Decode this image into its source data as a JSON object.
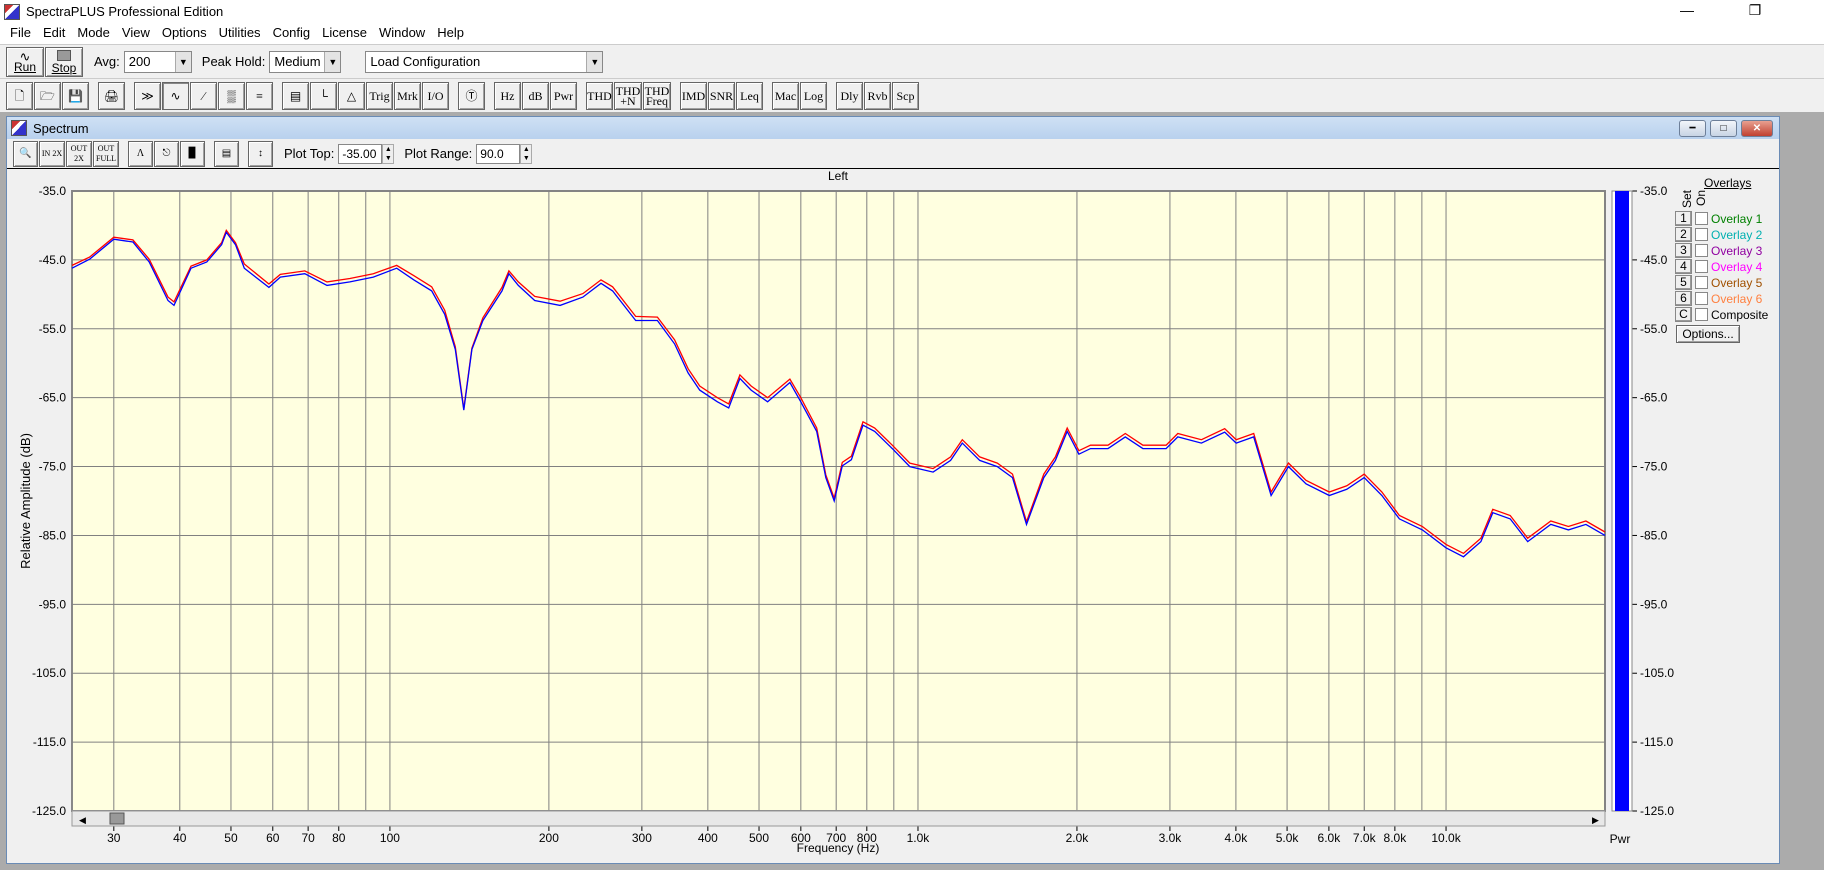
{
  "app": {
    "title": "SpectraPLUS Professional Edition",
    "window_controls": [
      "minimize",
      "restore"
    ]
  },
  "menu": [
    "File",
    "Edit",
    "Mode",
    "View",
    "Options",
    "Utilities",
    "Config",
    "License",
    "Window",
    "Help"
  ],
  "toolbar1": {
    "run_label": "Run",
    "stop_label": "Stop",
    "avg_label": "Avg:",
    "avg_value": "200",
    "peak_hold_label": "Peak Hold:",
    "peak_hold_value": "Medium",
    "config_value": "Load Configuration"
  },
  "toolbar2": {
    "icons_a": [
      "new-file",
      "open-file",
      "save-file",
      "print"
    ],
    "icons_b": [
      "averaging",
      "spectrum-mode",
      "phase",
      "spectrogram",
      "3d-surface"
    ],
    "icons_c": [
      "numeric-display",
      "scope",
      "generator"
    ],
    "labels": [
      "Trig",
      "Mrk",
      "I/O"
    ],
    "signal_icon": "sine-wave",
    "labels2": [
      "Hz",
      "dB",
      "Pwr"
    ],
    "labels3": [
      "THD",
      "THD +N",
      "THD Freq"
    ],
    "labels4": [
      "IMD",
      "SNR",
      "Leq"
    ],
    "labels5": [
      "Mac",
      "Log"
    ],
    "labels6": [
      "Dly",
      "Rvb",
      "Scp"
    ]
  },
  "spectrum": {
    "title": "Spectrum",
    "zoom_buttons": [
      "IN 2X",
      "OUT 2X",
      "OUT FULL"
    ],
    "plot_top_label": "Plot Top:",
    "plot_top_value": "-35.00",
    "plot_range_label": "Plot Range:",
    "plot_range_value": "90.0",
    "overlays": {
      "title": "Overlays",
      "set_label": "Set",
      "on_label": "On",
      "items": [
        {
          "set": "1",
          "label": "Overlay 1",
          "color": "#008000"
        },
        {
          "set": "2",
          "label": "Overlay 2",
          "color": "#00b0b0"
        },
        {
          "set": "3",
          "label": "Overlay 3",
          "color": "#9000a0"
        },
        {
          "set": "4",
          "label": "Overlay 4",
          "color": "#ff00ff"
        },
        {
          "set": "5",
          "label": "Overlay 5",
          "color": "#a05000"
        },
        {
          "set": "6",
          "label": "Overlay 6",
          "color": "#ff8040"
        },
        {
          "set": "C",
          "label": "Composite",
          "color": "#000000"
        }
      ],
      "options_label": "Options..."
    },
    "pwr_label": "Pwr",
    "pwr_color": "#0000ff",
    "pwr_level_percent": 100
  },
  "chart_data": {
    "type": "line",
    "title": "Left",
    "xlabel": "Frequency (Hz)",
    "ylabel": "Relative Amplitude (dB)",
    "xscale": "log",
    "xlim": [
      25,
      20000
    ],
    "ylim": [
      -125,
      -35
    ],
    "grid": true,
    "background": "#ffffe0",
    "yticks": [
      -35,
      -45,
      -55,
      -65,
      -75,
      -85,
      -95,
      -105,
      -115,
      -125
    ],
    "ytick_labels": [
      "-35.0",
      "-45.0",
      "-55.0",
      "-65.0",
      "-75.0",
      "-85.0",
      "-95.0",
      "-105.0",
      "-115.0",
      "-125.0"
    ],
    "xgrid": [
      30,
      40,
      50,
      60,
      70,
      80,
      90,
      100,
      200,
      300,
      400,
      500,
      600,
      700,
      800,
      900,
      1000,
      2000,
      3000,
      4000,
      5000,
      6000,
      7000,
      8000,
      9000,
      10000,
      20000
    ],
    "xticks": [
      30,
      40,
      50,
      60,
      70,
      80,
      100,
      200,
      300,
      400,
      500,
      600,
      700,
      800,
      1000,
      2000,
      3000,
      4000,
      5000,
      6000,
      7000,
      8000,
      10000
    ],
    "xtick_labels": [
      "30",
      "40",
      "50",
      "60",
      "70",
      "80",
      "100",
      "200",
      "300",
      "400",
      "500",
      "600",
      "700",
      "800",
      "1.0k",
      "2.0k",
      "3.0k",
      "4.0k",
      "5.0k",
      "6.0k",
      "7.0k",
      "8.0k",
      "10.0k"
    ],
    "x": [
      25,
      27,
      30,
      32.6,
      35,
      38,
      39,
      42,
      45,
      48,
      49,
      51,
      53,
      59,
      62,
      69,
      76,
      84,
      93,
      103,
      111,
      120,
      127,
      133,
      138,
      143,
      150,
      163,
      168,
      175,
      188,
      210,
      232,
      251,
      264,
      292,
      321,
      346,
      367,
      386,
      417,
      438,
      460,
      483,
      519,
      572,
      600,
      643,
      669,
      694,
      719,
      748,
      787,
      828,
      894,
      965,
      1068,
      1153,
      1213,
      1309,
      1413,
      1510,
      1605,
      1731,
      1821,
      1917,
      2017,
      2122,
      2290,
      2470,
      2667,
      2950,
      3105,
      3441,
      3810,
      4006,
      4322,
      4663,
      5032,
      5430,
      6010,
      6488,
      7000,
      7560,
      8160,
      9020,
      10000,
      10790,
      11640,
      12260,
      13230,
      14280,
      15790,
      17050,
      18400,
      20000
    ],
    "series": [
      {
        "color": "#0000ff",
        "values": [
          -46.2,
          -44.9,
          -42,
          -42.4,
          -45.3,
          -50.9,
          -51.6,
          -46.2,
          -45.3,
          -42.8,
          -41,
          -42.8,
          -46.2,
          -49,
          -47.5,
          -47,
          -48.7,
          -48.2,
          -47.5,
          -46.2,
          -47.9,
          -49.5,
          -52.9,
          -58,
          -66.8,
          -58,
          -53.8,
          -49.5,
          -47,
          -48.7,
          -50.9,
          -51.6,
          -50.4,
          -48.4,
          -49.5,
          -53.8,
          -53.8,
          -57.2,
          -61.4,
          -63.9,
          -65.6,
          -66.5,
          -62.2,
          -63.9,
          -65.6,
          -62.8,
          -65.6,
          -69.9,
          -76.6,
          -80,
          -74.9,
          -74,
          -69,
          -69.9,
          -72.4,
          -75,
          -75.8,
          -74.1,
          -71.6,
          -74.1,
          -75,
          -76.6,
          -83.4,
          -76.6,
          -74.1,
          -69.9,
          -73.2,
          -72.4,
          -72.4,
          -70.7,
          -72.4,
          -72.4,
          -70.7,
          -71.6,
          -70,
          -71.6,
          -70.7,
          -79.2,
          -75,
          -77.5,
          -79.2,
          -78.3,
          -76.6,
          -79.2,
          -82.6,
          -84.2,
          -86.8,
          -88.1,
          -85.9,
          -81.7,
          -82.6,
          -85.9,
          -83.4,
          -84.2,
          -83.4,
          -85,
          -87.6
        ]
      },
      {
        "color": "#ff0000",
        "values": [
          -45.8,
          -44.6,
          -41.7,
          -42.1,
          -44.9,
          -50.4,
          -51.1,
          -45.9,
          -45,
          -42.5,
          -40.7,
          -42.5,
          -45.6,
          -48.5,
          -47.1,
          -46.6,
          -48.2,
          -47.7,
          -47,
          -45.8,
          -47.3,
          -48.9,
          -52.3,
          -57.6,
          -66.6,
          -57.8,
          -53.4,
          -49,
          -46.6,
          -48.2,
          -50.3,
          -51,
          -49.9,
          -47.9,
          -48.9,
          -53.2,
          -53.3,
          -56.6,
          -60.8,
          -63.3,
          -65,
          -65.9,
          -61.7,
          -63.3,
          -65,
          -62.3,
          -65,
          -69.4,
          -76.2,
          -79.6,
          -74.4,
          -73.5,
          -68.5,
          -69.4,
          -71.9,
          -74.5,
          -75.3,
          -73.6,
          -71.1,
          -73.6,
          -74.5,
          -76.1,
          -83,
          -76.1,
          -73.6,
          -69.4,
          -72.7,
          -71.9,
          -71.9,
          -70.2,
          -71.9,
          -71.9,
          -70.2,
          -71.1,
          -69.5,
          -71.1,
          -70.2,
          -78.7,
          -74.5,
          -77,
          -78.7,
          -77.8,
          -76.1,
          -78.7,
          -82.1,
          -83.7,
          -86.3,
          -87.6,
          -85.4,
          -81.2,
          -82.1,
          -85.4,
          -82.9,
          -83.7,
          -82.9,
          -84.5,
          -87.1
        ]
      }
    ]
  }
}
